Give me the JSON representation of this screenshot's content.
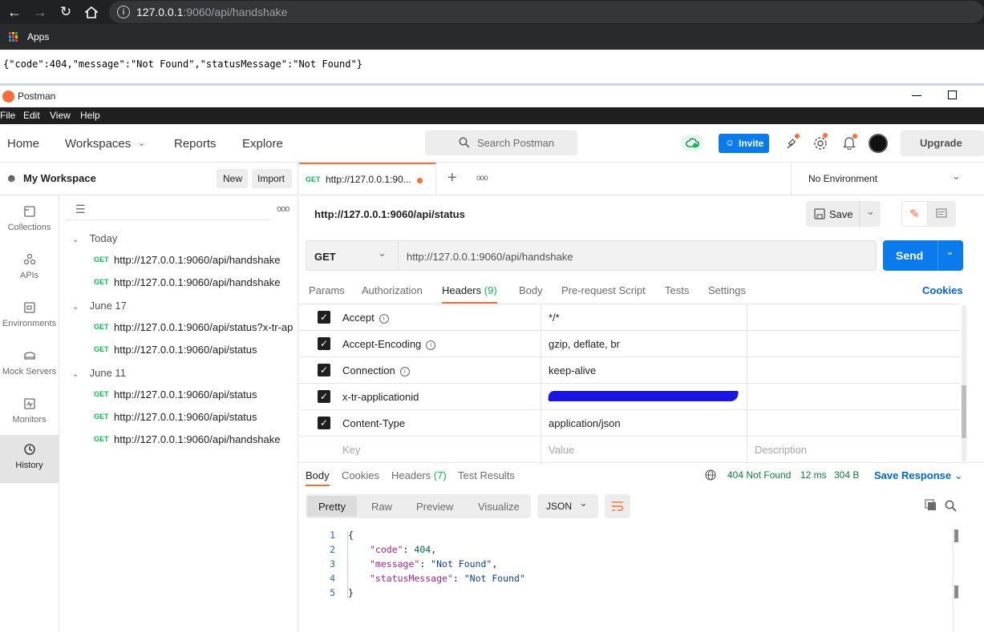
{
  "browser": {
    "url_host": "127.0.0.1",
    "url_path": ":9060/api/handshake",
    "bookmarks_label": "Apps",
    "raw_response": "{\"code\":404,\"message\":\"Not Found\",\"statusMessage\":\"Not Found\"}"
  },
  "window": {
    "title": "Postman",
    "menu": [
      "File",
      "Edit",
      "View",
      "Help"
    ]
  },
  "header": {
    "nav": [
      "Home",
      "Workspaces",
      "Reports",
      "Explore"
    ],
    "search_placeholder": "Search Postman",
    "invite_label": "Invite",
    "upgrade_label": "Upgrade"
  },
  "sidebar": {
    "workspace_name": "My Workspace",
    "new_label": "New",
    "import_label": "Import",
    "rail": [
      {
        "label": "Collections",
        "icon": "collections-icon"
      },
      {
        "label": "APIs",
        "icon": "apis-icon"
      },
      {
        "label": "Environments",
        "icon": "environments-icon"
      },
      {
        "label": "Mock Servers",
        "icon": "mock-servers-icon"
      },
      {
        "label": "Monitors",
        "icon": "monitors-icon"
      },
      {
        "label": "History",
        "icon": "history-icon",
        "active": true
      }
    ],
    "history": [
      {
        "group": "Today",
        "items": [
          {
            "method": "GET",
            "url": "http://127.0.0.1:9060/api/handshake"
          },
          {
            "method": "GET",
            "url": "http://127.0.0.1:9060/api/handshake"
          }
        ]
      },
      {
        "group": "June 17",
        "items": [
          {
            "method": "GET",
            "url": "http://127.0.0.1:9060/api/status?x-tr-ap"
          },
          {
            "method": "GET",
            "url": "http://127.0.0.1:9060/api/status"
          }
        ]
      },
      {
        "group": "June 11",
        "items": [
          {
            "method": "GET",
            "url": "http://127.0.0.1:9060/api/status"
          },
          {
            "method": "GET",
            "url": "http://127.0.0.1:9060/api/status"
          },
          {
            "method": "GET",
            "url": "http://127.0.0.1:9060/api/handshake"
          }
        ]
      }
    ]
  },
  "tabbar": {
    "tab_method": "GET",
    "tab_title": "http://127.0.0.1:90...",
    "add_label": "+",
    "more_label": "ooo",
    "environment": "No Environment"
  },
  "request": {
    "name": "http://127.0.0.1:9060/api/status",
    "save_label": "Save",
    "method": "GET",
    "url": "http://127.0.0.1:9060/api/handshake",
    "send_label": "Send",
    "tabs": [
      "Params",
      "Authorization",
      "Headers",
      "Body",
      "Pre-request Script",
      "Tests",
      "Settings"
    ],
    "headers_count": "(9)",
    "cookies_label": "Cookies",
    "headers": [
      {
        "key": "Accept",
        "value": "*/*",
        "info": true
      },
      {
        "key": "Accept-Encoding",
        "value": "gzip, deflate, br",
        "info": true
      },
      {
        "key": "Connection",
        "value": "keep-alive",
        "info": true
      },
      {
        "key": "x-tr-applicationid",
        "value": "",
        "redacted": true,
        "info": false
      },
      {
        "key": "Content-Type",
        "value": "application/json",
        "info": false
      }
    ],
    "placeholders": {
      "key": "Key",
      "value": "Value",
      "description": "Description"
    }
  },
  "response": {
    "tabs": [
      "Body",
      "Cookies",
      "Headers",
      "Test Results"
    ],
    "headers_count": "(7)",
    "status": "404 Not Found",
    "time": "12 ms",
    "size": "304 B",
    "save_response_label": "Save Response",
    "views": [
      "Pretty",
      "Raw",
      "Preview",
      "Visualize"
    ],
    "format": "JSON",
    "body_lines": [
      {
        "n": "1",
        "text": "{"
      },
      {
        "n": "2",
        "key": "\"code\"",
        "val": "404",
        "type": "num",
        "end": ","
      },
      {
        "n": "3",
        "key": "\"message\"",
        "val": "\"Not Found\"",
        "type": "str",
        "end": ","
      },
      {
        "n": "4",
        "key": "\"statusMessage\"",
        "val": "\"Not Found\"",
        "type": "str",
        "end": ""
      },
      {
        "n": "5",
        "text": "}"
      }
    ]
  },
  "colors": {
    "accent": "#ff6c37",
    "send_blue": "#097bed",
    "link_blue": "#0265d2",
    "get_green": "#0cbb52"
  }
}
